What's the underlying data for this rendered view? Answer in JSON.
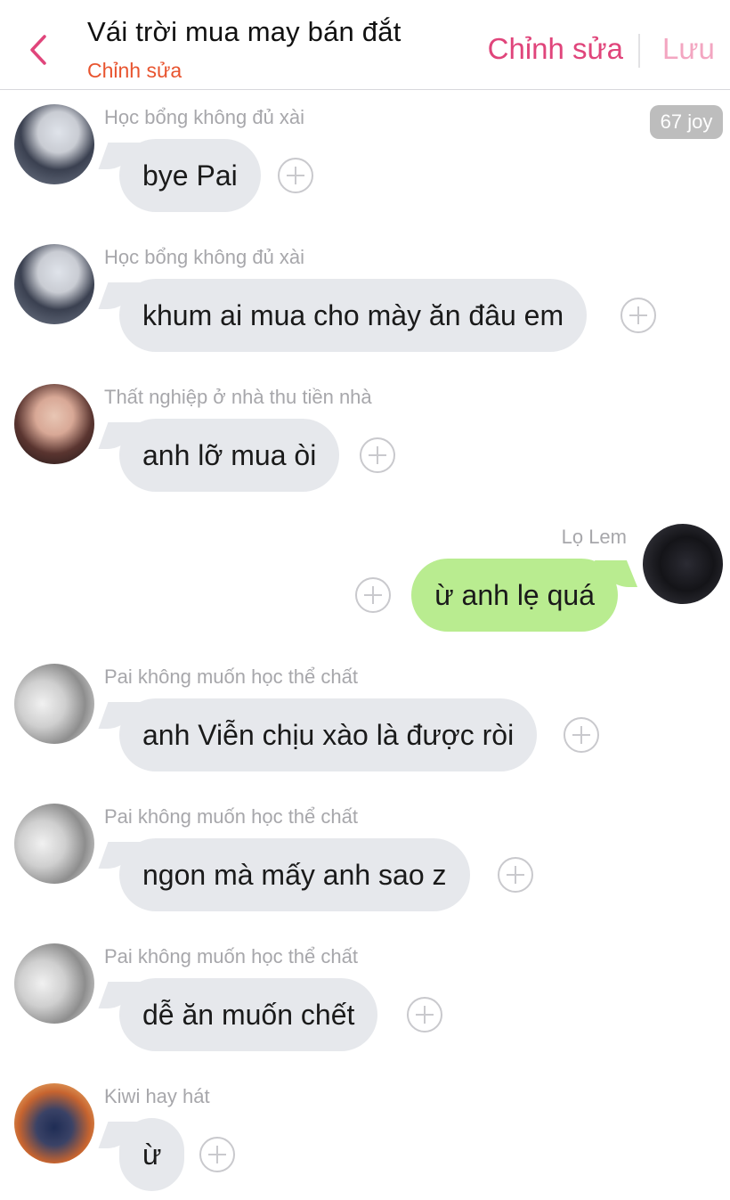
{
  "header": {
    "back_icon": "chevron-left-icon",
    "title": "Vái trời mua may bán đắt",
    "subtitle": "Chỉnh sửa",
    "edit_label": "Chỉnh sửa",
    "save_label": "Lưu",
    "accent": "#e0457b"
  },
  "joy_badge": "67 joy",
  "messages": [
    {
      "sender": "Học bổng không đủ xài",
      "text": "bye Pai",
      "direction": "incoming"
    },
    {
      "sender": "Học bổng không đủ xài",
      "text": "khum ai mua cho mày ăn đâu em",
      "direction": "incoming"
    },
    {
      "sender": "Thất nghiệp ở nhà thu tiền nhà",
      "text": "anh lỡ mua òi",
      "direction": "incoming"
    },
    {
      "sender": "Lọ Lem",
      "text": "ừ anh lẹ quá",
      "direction": "outgoing"
    },
    {
      "sender": "Pai không muốn học thể chất",
      "text": "anh Viễn chịu xào là được ròi",
      "direction": "incoming"
    },
    {
      "sender": "Pai không muốn học thể chất",
      "text": "ngon mà mấy anh sao z",
      "direction": "incoming"
    },
    {
      "sender": "Pai không muốn học thể chất",
      "text": "dễ ăn muốn chết",
      "direction": "incoming"
    },
    {
      "sender": "Kiwi hay hát",
      "text": "ừ",
      "direction": "incoming"
    }
  ],
  "colors": {
    "incoming_bubble": "#e6e8ec",
    "outgoing_bubble": "#b9ec90",
    "subtitle": "#e8542f"
  }
}
